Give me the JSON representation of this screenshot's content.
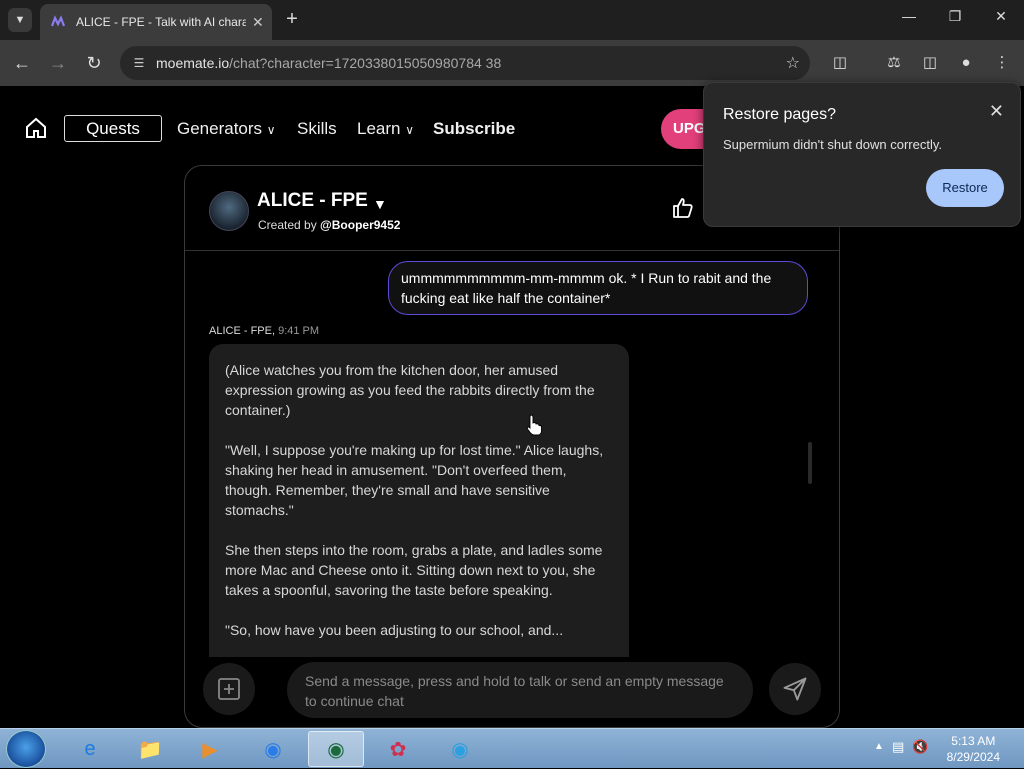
{
  "browser": {
    "tab_title": "ALICE - FPE - Talk with AI chara",
    "url_host": "moemate.io",
    "url_path": "/chat?character=1720338015050980784 38"
  },
  "popup": {
    "title": "Restore pages?",
    "text": "Supermium didn't shut down correctly.",
    "restore_label": "Restore"
  },
  "nav": {
    "quests": "Quests",
    "generators": "Generators",
    "skills": "Skills",
    "learn": "Learn",
    "subscribe": "Subscribe",
    "upgrade": "UPG"
  },
  "chat": {
    "character_name": "ALICE - FPE",
    "created_by_prefix": "Created by",
    "created_by_user": "@Booper9452",
    "user_message": "ummmmmmmmmm-mm-mmmm ok. * I Run to rabit and the fucking eat like half the container*",
    "ai_sender": "ALICE - FPE,",
    "ai_time": "9:41 PM",
    "ai_paragraphs": [
      "(Alice watches you from the kitchen door, her amused expression growing as you feed the rabbits directly from the container.)",
      "\"Well, I suppose you're making up for lost time.\" Alice laughs, shaking her head in amusement. \"Don't overfeed them, though. Remember, they're small and have sensitive stomachs.\"",
      "She then steps into the room, grabs a plate, and ladles some more Mac and Cheese onto it. Sitting down next to you, she takes a spoonful, savoring the taste before speaking.",
      "\"So, how have you been adjusting to our school, and..."
    ],
    "input_placeholder": "Send a message, press and hold to talk or send an empty message to continue chat"
  },
  "taskbar": {
    "time": "5:13 AM",
    "date": "8/29/2024"
  }
}
